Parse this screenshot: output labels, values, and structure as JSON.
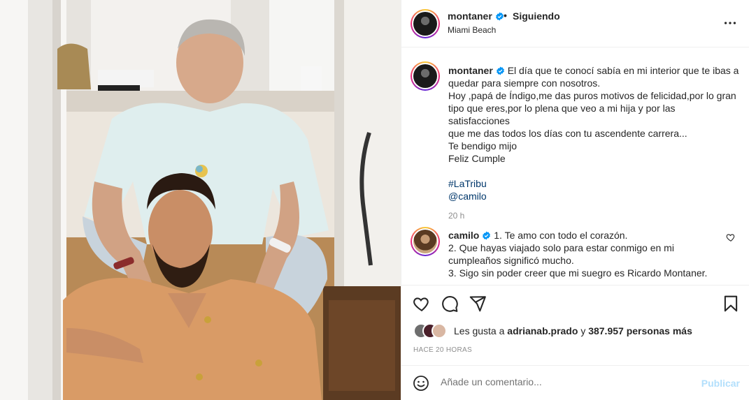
{
  "post": {
    "photo_alt": "Post photo",
    "colors": {
      "link": "#00376b",
      "verified": "#0095f6",
      "publish_disabled": "#b2dffc",
      "secondary_text": "#8e8e8e"
    }
  },
  "header": {
    "username": "montaner",
    "separator": "•",
    "follow_state": "Siguiendo",
    "location": "Miami Beach",
    "avatar_icon": "montaner-avatar",
    "more_icon": "more-options-icon"
  },
  "caption": {
    "username": "montaner",
    "lines": [
      "El día que te conocí sabía en mi interior que te ibas a",
      "quedar para siempre con nosotros.",
      "Hoy ,papá de Índigo,me das puros motivos de felicidad,por lo gran",
      "tipo que eres,por lo plena que veo a mi hija y por las satisfacciones",
      "que me das todos los días con tu ascendente carrera...",
      "Te bendigo mijo",
      "Feliz Cumple"
    ],
    "hashtag": "#LaTribu",
    "mention": "@camilo",
    "time": "20 h"
  },
  "comment": {
    "username": "camilo",
    "lines": [
      "1. Te amo con todo el corazón.",
      "2. Que hayas viajado solo para estar conmigo en mi",
      "cumpleaños significó mucho.",
      "3. Sigo sin poder creer que mi suegro es Ricardo Montaner."
    ],
    "like_icon": "heart-outline-icon"
  },
  "actions": {
    "icons": [
      "heart-icon",
      "comment-icon",
      "share-icon",
      "bookmark-icon"
    ]
  },
  "likes": {
    "prefix": "Les gusta a",
    "liker": "adrianab.prado",
    "connector": "y",
    "count_text": "387.957 personas más"
  },
  "time_ago": "HACE 20 HORAS",
  "add_comment": {
    "placeholder": "Añade un comentario...",
    "publish_label": "Publicar",
    "emoji_icon": "emoji-icon"
  }
}
